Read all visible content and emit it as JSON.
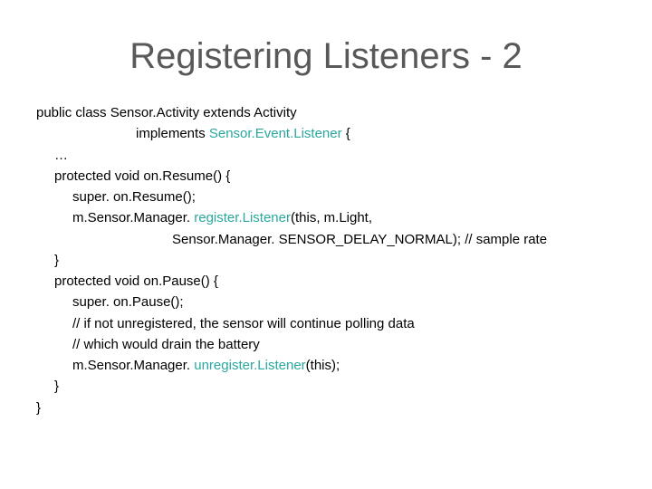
{
  "title": "Registering Listeners - 2",
  "code": {
    "l1a": "public class Sensor.Activity extends Activity",
    "l2a": "implements ",
    "l2b": "Sensor.Event.Listener",
    "l2c": " {",
    "l3": "…",
    "l4": "protected void on.Resume() {",
    "l5": "super. on.Resume();",
    "l6a": "m.Sensor.Manager. ",
    "l6b": "register.Listener",
    "l6c": "(this, m.Light,",
    "l7": "Sensor.Manager. SENSOR_DELAY_NORMAL); // sample rate",
    "l8": "}",
    "l9": "protected void on.Pause() {",
    "l10": "super. on.Pause();",
    "l11": "// if not unregistered, the sensor will continue polling data",
    "l12": "// which would drain the battery",
    "l13a": "m.Sensor.Manager. ",
    "l13b": "unregister.Listener",
    "l13c": "(this);",
    "l14": "}",
    "l15": "}"
  }
}
